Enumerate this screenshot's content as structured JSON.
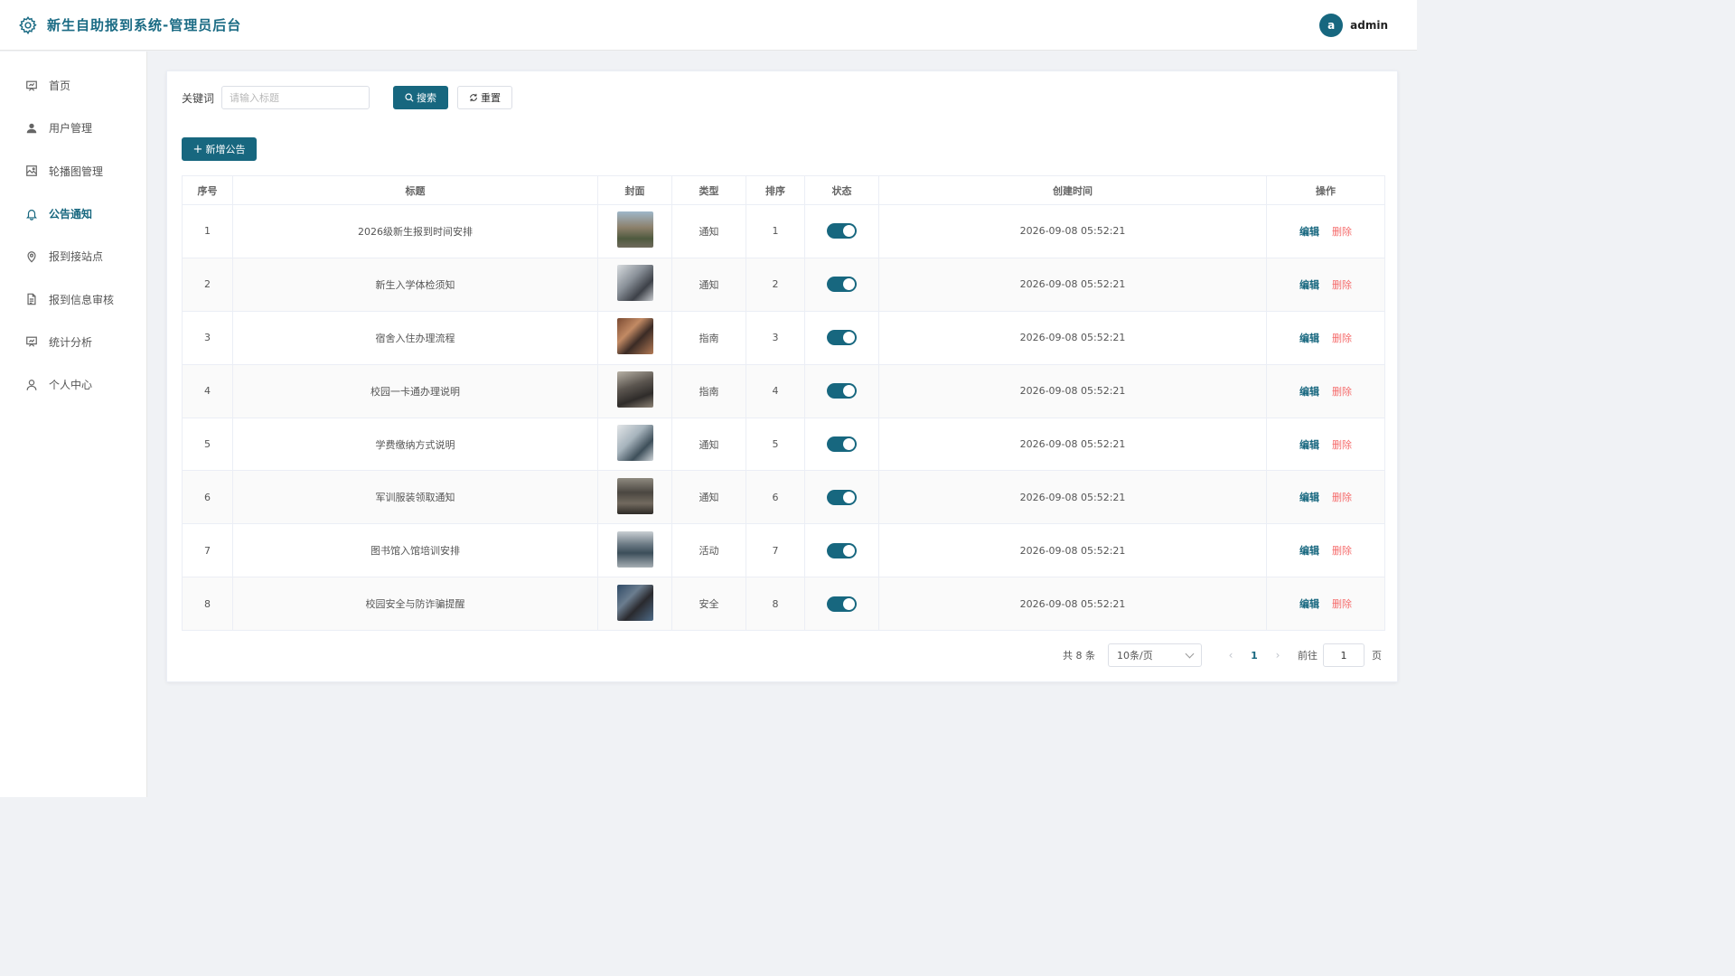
{
  "header": {
    "title": "新生自助报到系统-管理员后台",
    "avatar_letter": "a",
    "username": "admin"
  },
  "sidebar": {
    "items": [
      {
        "label": "首页",
        "icon": "dashboard-icon",
        "active": false
      },
      {
        "label": "用户管理",
        "icon": "user-icon",
        "active": false
      },
      {
        "label": "轮播图管理",
        "icon": "image-icon",
        "active": false
      },
      {
        "label": "公告通知",
        "icon": "bell-icon",
        "active": true
      },
      {
        "label": "报到接站点",
        "icon": "location-icon",
        "active": false
      },
      {
        "label": "报到信息审核",
        "icon": "document-icon",
        "active": false
      },
      {
        "label": "统计分析",
        "icon": "chart-icon",
        "active": false
      },
      {
        "label": "个人中心",
        "icon": "person-icon",
        "active": false
      }
    ]
  },
  "search": {
    "keyword_label": "关键词",
    "placeholder": "请输入标题",
    "search_label": "搜索",
    "reset_label": "重置"
  },
  "toolbar": {
    "add_label": "新增公告"
  },
  "table": {
    "headers": [
      "序号",
      "标题",
      "封面",
      "类型",
      "排序",
      "状态",
      "创建时间",
      "操作"
    ],
    "edit_label": "编辑",
    "delete_label": "删除",
    "rows": [
      {
        "index": "1",
        "title": "2026级新生报到时间安排",
        "type": "通知",
        "sort": "1",
        "status": true,
        "created": "2026-09-08 05:52:21"
      },
      {
        "index": "2",
        "title": "新生入学体检须知",
        "type": "通知",
        "sort": "2",
        "status": true,
        "created": "2026-09-08 05:52:21"
      },
      {
        "index": "3",
        "title": "宿舍入住办理流程",
        "type": "指南",
        "sort": "3",
        "status": true,
        "created": "2026-09-08 05:52:21"
      },
      {
        "index": "4",
        "title": "校园一卡通办理说明",
        "type": "指南",
        "sort": "4",
        "status": true,
        "created": "2026-09-08 05:52:21"
      },
      {
        "index": "5",
        "title": "学费缴纳方式说明",
        "type": "通知",
        "sort": "5",
        "status": true,
        "created": "2026-09-08 05:52:21"
      },
      {
        "index": "6",
        "title": "军训服装领取通知",
        "type": "通知",
        "sort": "6",
        "status": true,
        "created": "2026-09-08 05:52:21"
      },
      {
        "index": "7",
        "title": "图书馆入馆培训安排",
        "type": "活动",
        "sort": "7",
        "status": true,
        "created": "2026-09-08 05:52:21"
      },
      {
        "index": "8",
        "title": "校园安全与防诈骗提醒",
        "type": "安全",
        "sort": "8",
        "status": true,
        "created": "2026-09-08 05:52:21"
      }
    ]
  },
  "pagination": {
    "total": "共 8 条",
    "page_size": "10条/页",
    "current": "1",
    "goto_label": "前往",
    "goto_value": "1",
    "page_label": "页"
  },
  "colors": {
    "accent": "#17677f",
    "danger": "#f56c6c"
  }
}
